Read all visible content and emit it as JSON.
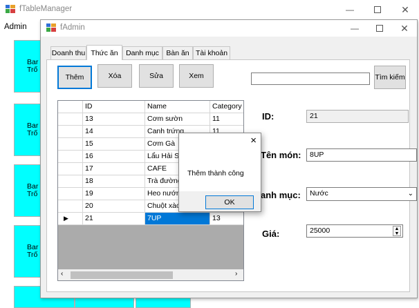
{
  "parent_window": {
    "title": "fTableManager",
    "menu": {
      "admin": "Admin"
    },
    "table_buttons": [
      {
        "lines": [
          "Bar",
          "Trố"
        ]
      },
      {
        "lines": [
          "Bar",
          "Trố"
        ]
      },
      {
        "lines": [
          "Bar",
          "Trố"
        ]
      },
      {
        "lines": [
          "Bar",
          "Trố"
        ]
      }
    ]
  },
  "admin_window": {
    "title": "fAdmin",
    "tabs": [
      {
        "label": "Doanh thu",
        "active": false
      },
      {
        "label": "Thức ăn",
        "active": true
      },
      {
        "label": "Danh mục",
        "active": false
      },
      {
        "label": "Bàn ăn",
        "active": false
      },
      {
        "label": "Tài khoản",
        "active": false
      }
    ],
    "toolbar": {
      "add": "Thêm",
      "delete": "Xóa",
      "edit": "Sửa",
      "view": "Xem"
    },
    "search": {
      "value": "",
      "button": "Tìm kiếm"
    },
    "grid": {
      "columns": [
        "ID",
        "Name",
        "Category"
      ],
      "rows": [
        {
          "id": "13",
          "name": "Cơm sườn",
          "category": "11"
        },
        {
          "id": "14",
          "name": "Canh trứng",
          "category": "11"
        },
        {
          "id": "15",
          "name": "Cơm Gà",
          "category": "11"
        },
        {
          "id": "16",
          "name": "Lẩu Hải Sản",
          "category": "12"
        },
        {
          "id": "17",
          "name": "CAFE",
          "category": "13"
        },
        {
          "id": "18",
          "name": "Trà đường",
          "category": "13"
        },
        {
          "id": "19",
          "name": "Heo nướng",
          "category": "14"
        },
        {
          "id": "20",
          "name": "Chuột xào",
          "category": "14"
        },
        {
          "id": "21",
          "name": "7UP",
          "category": "13",
          "selected": true
        }
      ]
    },
    "form": {
      "id_label": "ID:",
      "id_value": "21",
      "name_label": "Tên món:",
      "name_value": "8UP",
      "category_label": "anh mục:",
      "category_value": "Nước",
      "price_label": "Giá:",
      "price_value": "25000"
    }
  },
  "message_box": {
    "message": "Thêm thành công",
    "ok": "OK",
    "close": "×"
  },
  "colors": {
    "table_button": "#00ffff",
    "selection": "#0078d7",
    "focus_border": "#0078d7"
  }
}
